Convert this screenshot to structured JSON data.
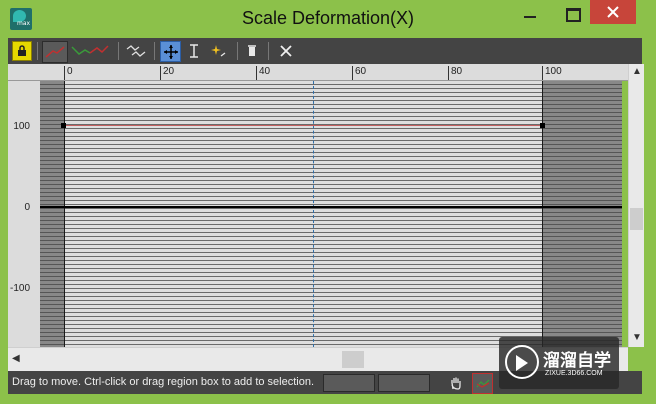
{
  "window": {
    "title": "Scale Deformation(X)",
    "app_badge": "max"
  },
  "toolbar": {
    "items": [
      {
        "name": "lock-aspect",
        "icon": "lock-icon"
      },
      {
        "name": "display-x-curve",
        "icon": "red-curve-icon"
      },
      {
        "name": "display-xy-curves",
        "icon": "red-green-curve-icon"
      },
      {
        "name": "swap-curves",
        "icon": "swap-curves-icon"
      },
      {
        "name": "move-control-point",
        "icon": "move-arrows-icon"
      },
      {
        "name": "scale-control-point",
        "icon": "scale-vertical-icon"
      },
      {
        "name": "insert-corner-point",
        "icon": "insert-point-icon"
      },
      {
        "name": "delete-control-point",
        "icon": "delete-point-icon"
      },
      {
        "name": "reset-curve",
        "icon": "reset-x-icon"
      }
    ]
  },
  "ruler": {
    "labels": [
      "0",
      "20",
      "40",
      "60",
      "80",
      "100"
    ]
  },
  "axis": {
    "labels": [
      "100",
      "0",
      "-100"
    ]
  },
  "status": {
    "text": "Drag to move. Ctrl-click or drag region box to add to selection.",
    "field1": "",
    "field2": ""
  },
  "watermark": {
    "title": "溜溜自学",
    "subtitle": "ZIXUE.3D66.COM"
  },
  "colors": {
    "frame": "#8cc14a",
    "toolbar": "#444444",
    "curve": "#c36060",
    "close": "#c7453a"
  }
}
